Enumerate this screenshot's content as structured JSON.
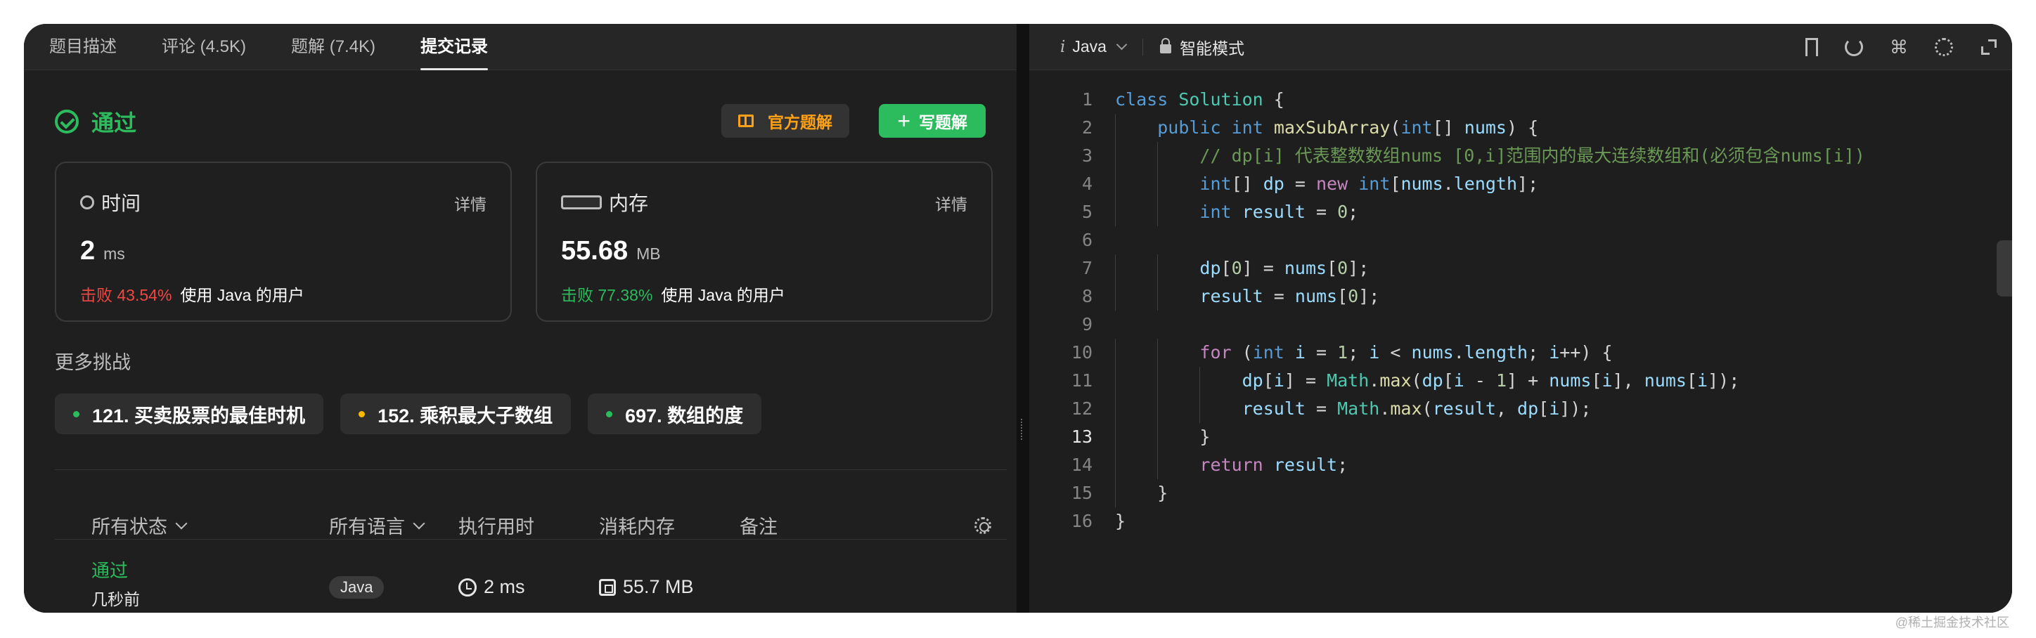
{
  "tabs": [
    {
      "label": "题目描述"
    },
    {
      "label": "评论 (4.5K)"
    },
    {
      "label": "题解 (7.4K)"
    },
    {
      "label": "提交记录"
    }
  ],
  "status": {
    "text": "通过",
    "official_solution": "官方题解",
    "write_solution": "写题解"
  },
  "time_card": {
    "title": "时间",
    "detail": "详情",
    "value": "2",
    "unit": "ms",
    "beat_pct": "击败 43.54%",
    "beat_text": "使用 Java 的用户"
  },
  "memory_card": {
    "title": "内存",
    "detail": "详情",
    "value": "55.68",
    "unit": "MB",
    "beat_pct": "击败 77.38%",
    "beat_text": "使用 Java 的用户"
  },
  "more": {
    "title": "更多挑战",
    "items": [
      {
        "label": "121. 买卖股票的最佳时机",
        "color": "#2cbb5d"
      },
      {
        "label": "152. 乘积最大子数组",
        "color": "#ffb800"
      },
      {
        "label": "697. 数组的度",
        "color": "#2cbb5d"
      }
    ]
  },
  "table": {
    "headers": [
      "所有状态",
      "所有语言",
      "执行用时",
      "消耗内存",
      "备注"
    ],
    "rows": [
      {
        "status": "通过",
        "time_ago": "几秒前",
        "lang": "Java",
        "runtime": "2 ms",
        "memory": "55.7 MB"
      }
    ]
  },
  "editor": {
    "language": "Java",
    "mode": "智能模式",
    "current_line": 13,
    "lines": [
      "class Solution {",
      "    public int maxSubArray(int[] nums) {",
      "        // dp[i] 代表整数数组nums [0,i]范围内的最大连续数组和(必须包含nums[i])",
      "        int[] dp = new int[nums.length];",
      "        int result = 0;",
      "",
      "        dp[0] = nums[0];",
      "        result = nums[0];",
      "",
      "        for (int i = 1; i < nums.length; i++) {",
      "            dp[i] = Math.max(dp[i - 1] + nums[i], nums[i]);",
      "            result = Math.max(result, dp[i]);",
      "        }",
      "        return result;",
      "    }",
      "}"
    ]
  },
  "watermark": "@稀土掘金技术社区",
  "colors": {
    "accent_green": "#2cbb5d",
    "accent_orange": "#ffa116",
    "beat_red": "#ef4743"
  }
}
